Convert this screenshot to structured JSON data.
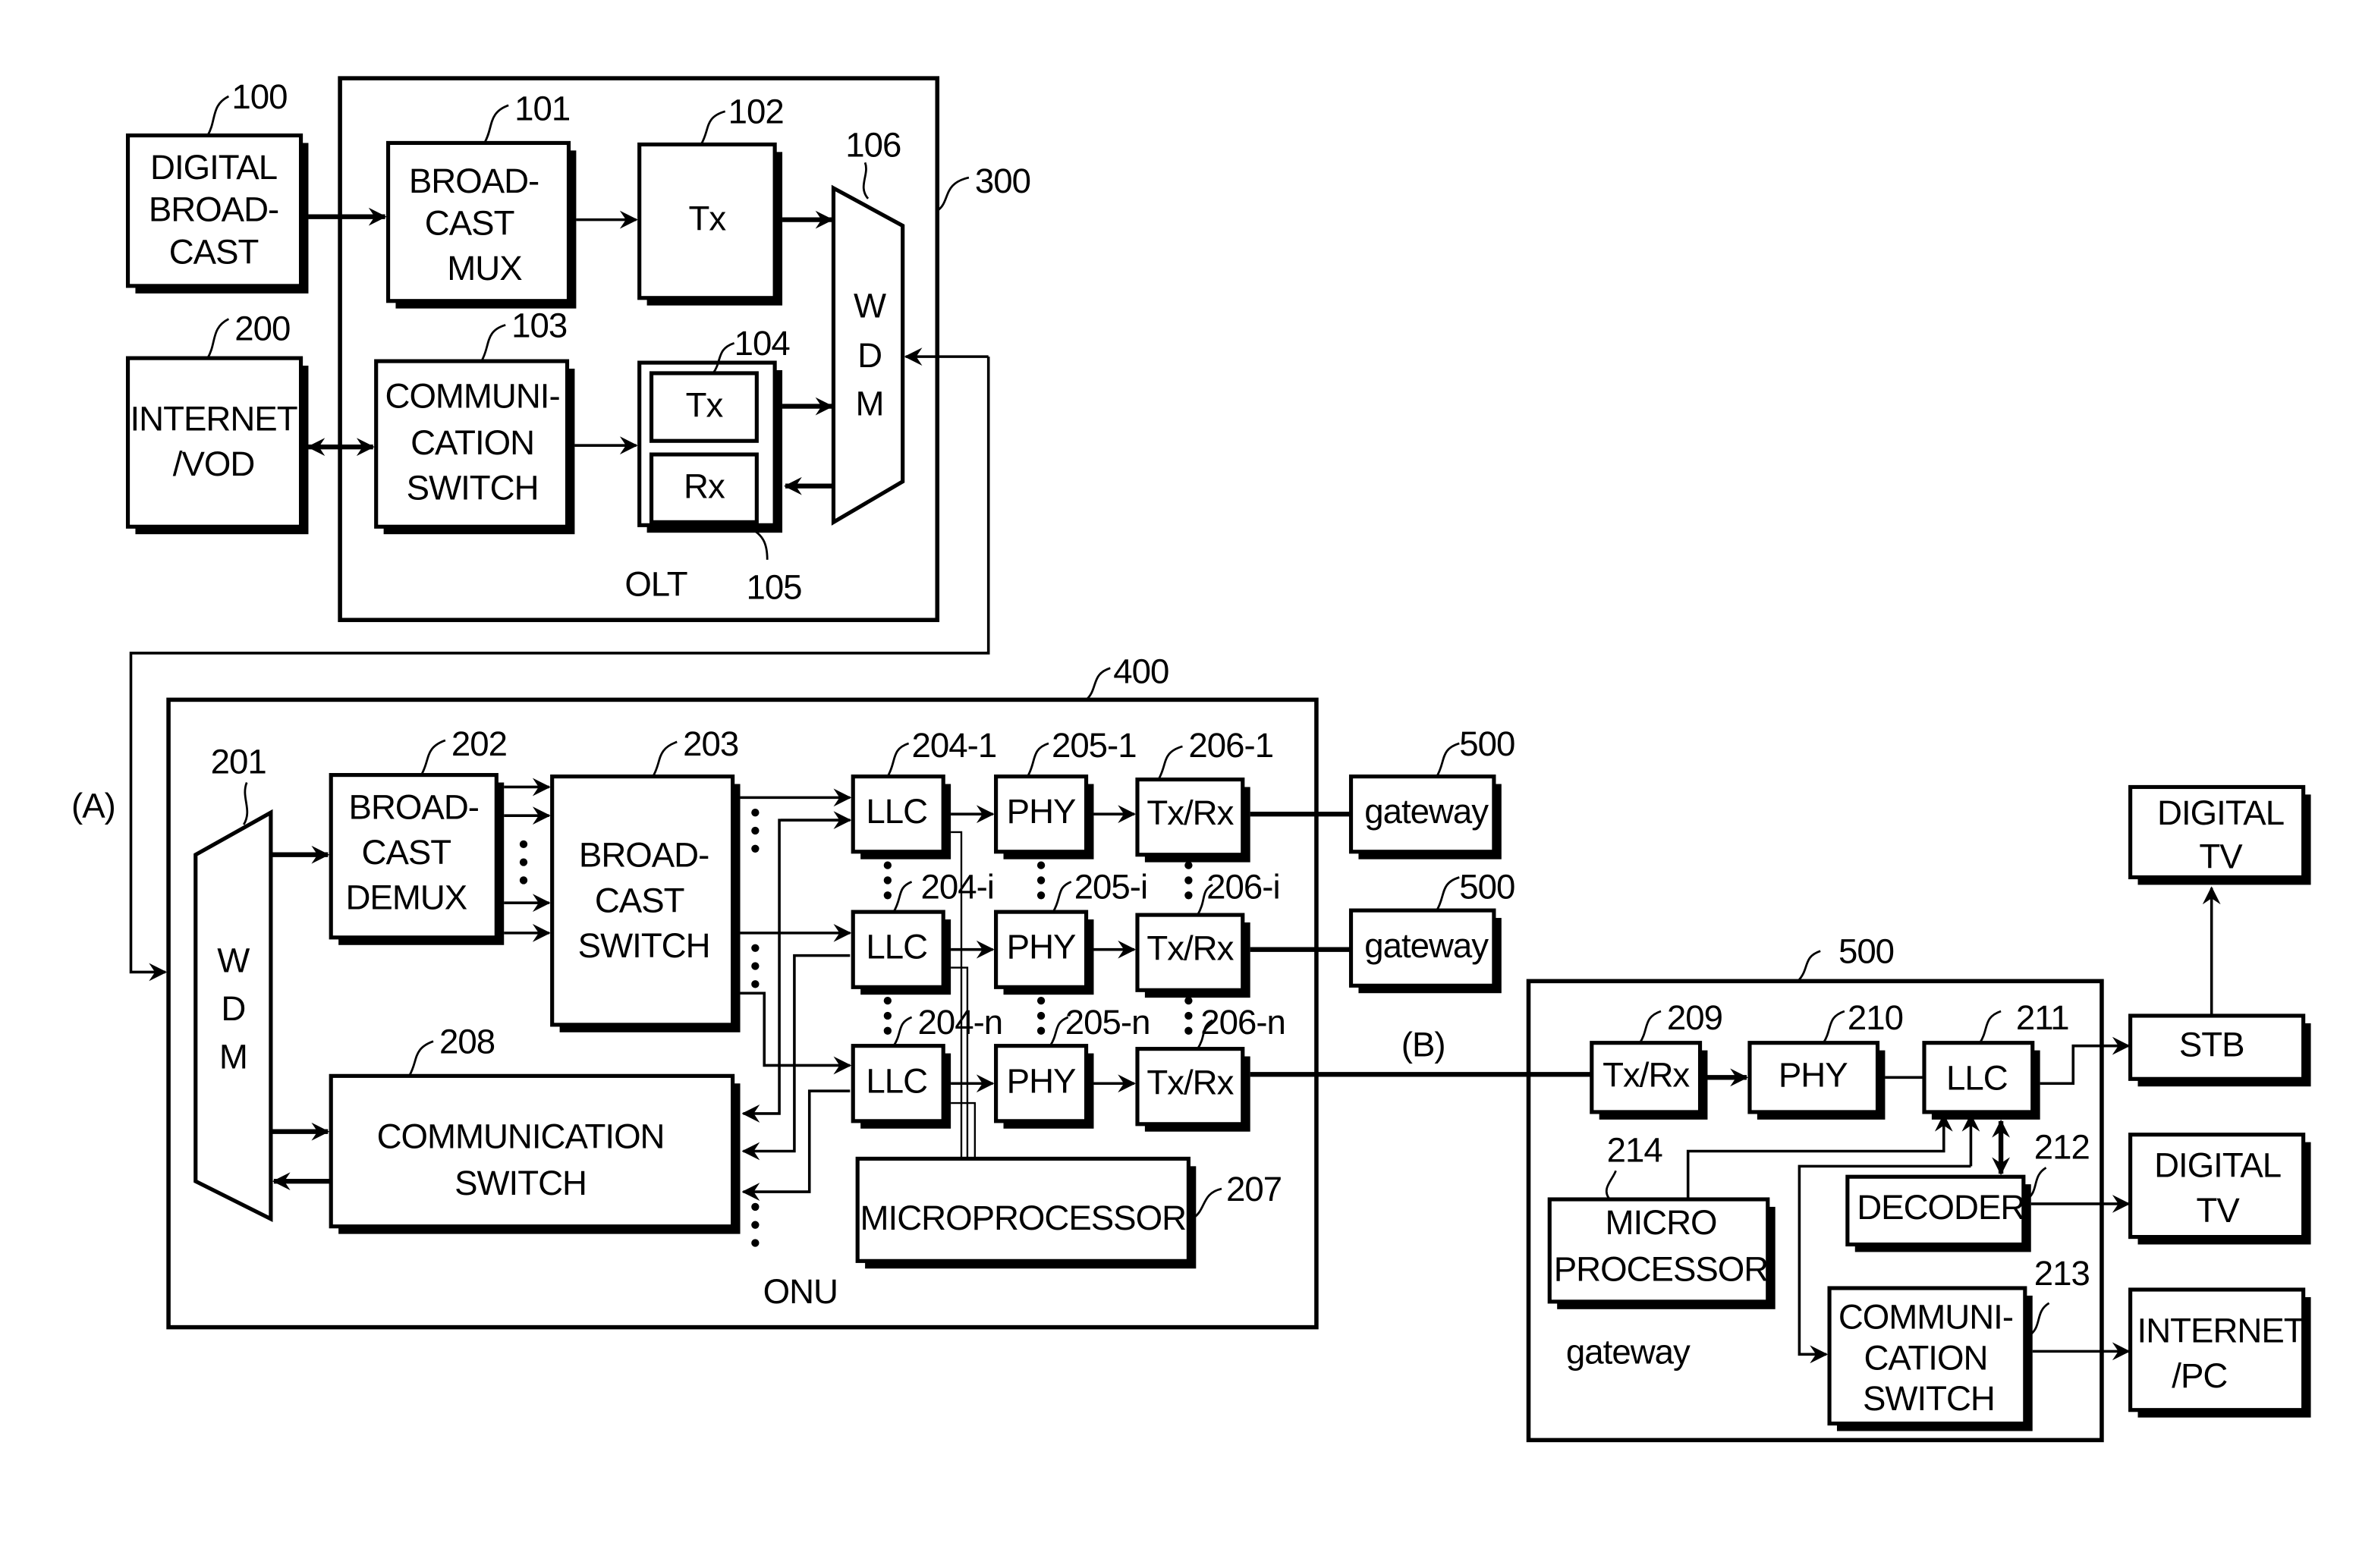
{
  "diagram": {
    "type": "block-diagram",
    "subject": "Optical network broadcast/communication system (OLT - ONU - gateway)"
  },
  "sources": {
    "digital_broadcast": {
      "ref": "100",
      "lines": [
        "DIGITAL",
        "BROAD-",
        "CAST"
      ]
    },
    "internet_vod": {
      "ref": "200",
      "lines": [
        "INTERNET",
        "/VOD"
      ]
    }
  },
  "olt": {
    "ref": "300",
    "label": "OLT",
    "broadcast_mux": {
      "ref": "101",
      "lines": [
        "BROAD-",
        "CAST",
        "MUX"
      ]
    },
    "tx": {
      "ref": "102",
      "label": "Tx"
    },
    "comm_switch": {
      "ref": "103",
      "lines": [
        "COMMUNI-",
        "CATION",
        "SWITCH"
      ]
    },
    "transceiver": {
      "ref_tx": "104",
      "ref_rx": "105",
      "tx_label": "Tx",
      "rx_label": "Rx"
    },
    "wdm": {
      "ref": "106",
      "letters": [
        "W",
        "D",
        "M"
      ]
    }
  },
  "links": {
    "a_label": "(A)",
    "b_label": "(B)"
  },
  "onu": {
    "ref": "400",
    "label": "ONU",
    "wdm": {
      "ref": "201",
      "letters": [
        "W",
        "D",
        "M"
      ]
    },
    "broadcast_demux": {
      "ref": "202",
      "lines": [
        "BROAD-",
        "CAST",
        "DEMUX"
      ]
    },
    "broadcast_switch": {
      "ref": "203",
      "lines": [
        "BROAD-",
        "CAST",
        "SWITCH"
      ]
    },
    "comm_switch": {
      "ref": "208",
      "lines": [
        "COMMUNICATION",
        "SWITCH"
      ]
    },
    "microprocessor": {
      "ref": "207",
      "label": "MICROPROCESSOR"
    },
    "channels": [
      {
        "llc_ref": "204-1",
        "phy_ref": "205-1",
        "txrx_ref": "206-1",
        "llc": "LLC",
        "phy": "PHY",
        "txrx": "Tx/Rx"
      },
      {
        "llc_ref": "204-i",
        "phy_ref": "205-i",
        "txrx_ref": "206-i",
        "llc": "LLC",
        "phy": "PHY",
        "txrx": "Tx/Rx"
      },
      {
        "llc_ref": "204-n",
        "phy_ref": "205-n",
        "txrx_ref": "206-n",
        "llc": "LLC",
        "phy": "PHY",
        "txrx": "Tx/Rx"
      }
    ]
  },
  "external_gateways": [
    {
      "ref": "500",
      "label": "gateway"
    },
    {
      "ref": "500",
      "label": "gateway"
    }
  ],
  "gateway": {
    "ref": "500",
    "label": "gateway",
    "txrx": {
      "ref": "209",
      "label": "Tx/Rx"
    },
    "phy": {
      "ref": "210",
      "label": "PHY"
    },
    "llc": {
      "ref": "211",
      "label": "LLC"
    },
    "decoder": {
      "ref": "212",
      "label": "DECODER"
    },
    "comm_switch": {
      "ref": "213",
      "lines": [
        "COMMUNI-",
        "CATION",
        "SWITCH"
      ]
    },
    "microprocessor": {
      "ref": "214",
      "lines": [
        "MICRO",
        "PROCESSOR"
      ]
    }
  },
  "endpoints": {
    "stb": {
      "label": "STB"
    },
    "digital_tv_top": {
      "lines": [
        "DIGITAL",
        "TV"
      ]
    },
    "digital_tv_mid": {
      "lines": [
        "DIGITAL",
        "TV"
      ]
    },
    "internet_pc": {
      "lines": [
        "INTERNET",
        "/PC"
      ]
    }
  }
}
